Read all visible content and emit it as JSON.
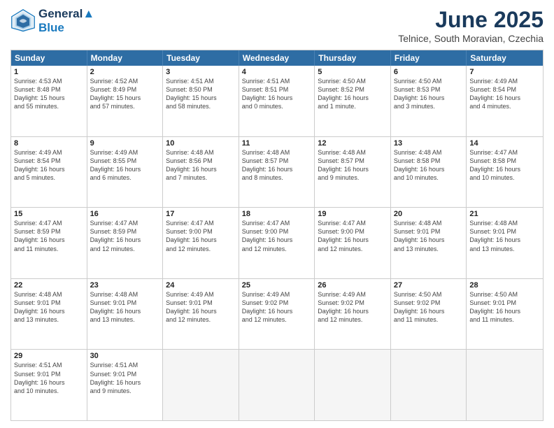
{
  "header": {
    "logo_line1": "General",
    "logo_line2": "Blue",
    "month_year": "June 2025",
    "location": "Telnice, South Moravian, Czechia"
  },
  "weekdays": [
    "Sunday",
    "Monday",
    "Tuesday",
    "Wednesday",
    "Thursday",
    "Friday",
    "Saturday"
  ],
  "rows": [
    [
      {
        "day": "1",
        "text": "Sunrise: 4:53 AM\nSunset: 8:48 PM\nDaylight: 15 hours\nand 55 minutes."
      },
      {
        "day": "2",
        "text": "Sunrise: 4:52 AM\nSunset: 8:49 PM\nDaylight: 15 hours\nand 57 minutes."
      },
      {
        "day": "3",
        "text": "Sunrise: 4:51 AM\nSunset: 8:50 PM\nDaylight: 15 hours\nand 58 minutes."
      },
      {
        "day": "4",
        "text": "Sunrise: 4:51 AM\nSunset: 8:51 PM\nDaylight: 16 hours\nand 0 minutes."
      },
      {
        "day": "5",
        "text": "Sunrise: 4:50 AM\nSunset: 8:52 PM\nDaylight: 16 hours\nand 1 minute."
      },
      {
        "day": "6",
        "text": "Sunrise: 4:50 AM\nSunset: 8:53 PM\nDaylight: 16 hours\nand 3 minutes."
      },
      {
        "day": "7",
        "text": "Sunrise: 4:49 AM\nSunset: 8:54 PM\nDaylight: 16 hours\nand 4 minutes."
      }
    ],
    [
      {
        "day": "8",
        "text": "Sunrise: 4:49 AM\nSunset: 8:54 PM\nDaylight: 16 hours\nand 5 minutes."
      },
      {
        "day": "9",
        "text": "Sunrise: 4:49 AM\nSunset: 8:55 PM\nDaylight: 16 hours\nand 6 minutes."
      },
      {
        "day": "10",
        "text": "Sunrise: 4:48 AM\nSunset: 8:56 PM\nDaylight: 16 hours\nand 7 minutes."
      },
      {
        "day": "11",
        "text": "Sunrise: 4:48 AM\nSunset: 8:57 PM\nDaylight: 16 hours\nand 8 minutes."
      },
      {
        "day": "12",
        "text": "Sunrise: 4:48 AM\nSunset: 8:57 PM\nDaylight: 16 hours\nand 9 minutes."
      },
      {
        "day": "13",
        "text": "Sunrise: 4:48 AM\nSunset: 8:58 PM\nDaylight: 16 hours\nand 10 minutes."
      },
      {
        "day": "14",
        "text": "Sunrise: 4:47 AM\nSunset: 8:58 PM\nDaylight: 16 hours\nand 10 minutes."
      }
    ],
    [
      {
        "day": "15",
        "text": "Sunrise: 4:47 AM\nSunset: 8:59 PM\nDaylight: 16 hours\nand 11 minutes."
      },
      {
        "day": "16",
        "text": "Sunrise: 4:47 AM\nSunset: 8:59 PM\nDaylight: 16 hours\nand 12 minutes."
      },
      {
        "day": "17",
        "text": "Sunrise: 4:47 AM\nSunset: 9:00 PM\nDaylight: 16 hours\nand 12 minutes."
      },
      {
        "day": "18",
        "text": "Sunrise: 4:47 AM\nSunset: 9:00 PM\nDaylight: 16 hours\nand 12 minutes."
      },
      {
        "day": "19",
        "text": "Sunrise: 4:47 AM\nSunset: 9:00 PM\nDaylight: 16 hours\nand 12 minutes."
      },
      {
        "day": "20",
        "text": "Sunrise: 4:48 AM\nSunset: 9:01 PM\nDaylight: 16 hours\nand 13 minutes."
      },
      {
        "day": "21",
        "text": "Sunrise: 4:48 AM\nSunset: 9:01 PM\nDaylight: 16 hours\nand 13 minutes."
      }
    ],
    [
      {
        "day": "22",
        "text": "Sunrise: 4:48 AM\nSunset: 9:01 PM\nDaylight: 16 hours\nand 13 minutes."
      },
      {
        "day": "23",
        "text": "Sunrise: 4:48 AM\nSunset: 9:01 PM\nDaylight: 16 hours\nand 13 minutes."
      },
      {
        "day": "24",
        "text": "Sunrise: 4:49 AM\nSunset: 9:01 PM\nDaylight: 16 hours\nand 12 minutes."
      },
      {
        "day": "25",
        "text": "Sunrise: 4:49 AM\nSunset: 9:02 PM\nDaylight: 16 hours\nand 12 minutes."
      },
      {
        "day": "26",
        "text": "Sunrise: 4:49 AM\nSunset: 9:02 PM\nDaylight: 16 hours\nand 12 minutes."
      },
      {
        "day": "27",
        "text": "Sunrise: 4:50 AM\nSunset: 9:02 PM\nDaylight: 16 hours\nand 11 minutes."
      },
      {
        "day": "28",
        "text": "Sunrise: 4:50 AM\nSunset: 9:01 PM\nDaylight: 16 hours\nand 11 minutes."
      }
    ],
    [
      {
        "day": "29",
        "text": "Sunrise: 4:51 AM\nSunset: 9:01 PM\nDaylight: 16 hours\nand 10 minutes."
      },
      {
        "day": "30",
        "text": "Sunrise: 4:51 AM\nSunset: 9:01 PM\nDaylight: 16 hours\nand 9 minutes."
      },
      {
        "day": "",
        "text": ""
      },
      {
        "day": "",
        "text": ""
      },
      {
        "day": "",
        "text": ""
      },
      {
        "day": "",
        "text": ""
      },
      {
        "day": "",
        "text": ""
      }
    ]
  ]
}
